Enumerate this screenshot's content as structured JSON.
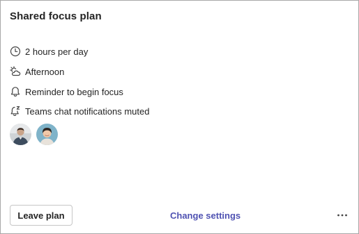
{
  "card": {
    "title": "Shared focus plan",
    "items": [
      {
        "icon": "clock-icon",
        "label": "2 hours per day"
      },
      {
        "icon": "weather-afternoon-icon",
        "label": "Afternoon"
      },
      {
        "icon": "bell-icon",
        "label": "Reminder to begin focus"
      },
      {
        "icon": "muted-notification-icon",
        "label": "Teams chat notifications muted"
      }
    ],
    "participants": [
      {
        "icon": "avatar-person-1"
      },
      {
        "icon": "avatar-person-2"
      }
    ],
    "actions": {
      "leave_label": "Leave plan",
      "change_settings_label": "Change settings",
      "more_icon": "more-options-icon"
    }
  },
  "colors": {
    "accent": "#4f52b2",
    "text": "#242424",
    "border": "#a8a8a8"
  }
}
